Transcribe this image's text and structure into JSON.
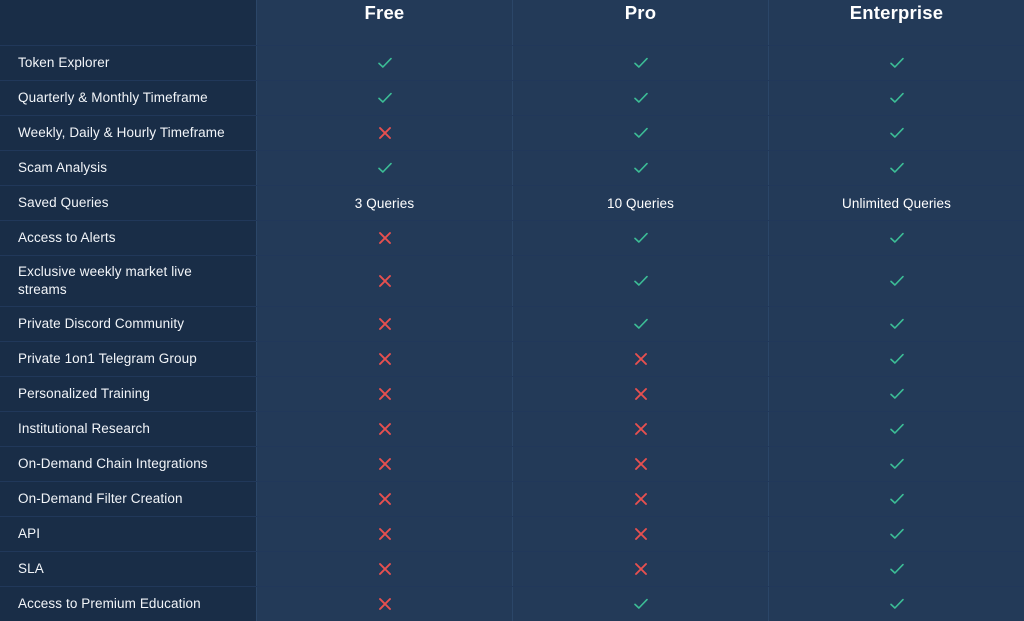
{
  "table": {
    "columns": [
      {
        "key": "feature",
        "label": ""
      },
      {
        "key": "free",
        "label": "Free"
      },
      {
        "key": "pro",
        "label": "Pro"
      },
      {
        "key": "enterprise",
        "label": "Enterprise"
      }
    ],
    "colors": {
      "label_column_bg": "#192d47",
      "value_column_bg": "#233a58",
      "row_divider": "#21385a",
      "column_divider": "#2b4668",
      "check": "#3cbd96",
      "cross": "#e8504f",
      "text": "#f2f5f9"
    },
    "icons": {
      "check": "check-icon",
      "cross": "cross-icon"
    },
    "rows": [
      {
        "label": "Token Explorer",
        "free": "check",
        "pro": "check",
        "enterprise": "check"
      },
      {
        "label": "Quarterly & Monthly Timeframe",
        "free": "check",
        "pro": "check",
        "enterprise": "check"
      },
      {
        "label": "Weekly, Daily & Hourly Timeframe",
        "free": "cross",
        "pro": "check",
        "enterprise": "check"
      },
      {
        "label": "Scam Analysis",
        "free": "check",
        "pro": "check",
        "enterprise": "check"
      },
      {
        "label": "Saved Queries",
        "free": "3 Queries",
        "pro": "10 Queries",
        "enterprise": "Unlimited Queries"
      },
      {
        "label": "Access to Alerts",
        "free": "cross",
        "pro": "check",
        "enterprise": "check"
      },
      {
        "label": "Exclusive weekly market live streams",
        "free": "cross",
        "pro": "check",
        "enterprise": "check",
        "tall": true
      },
      {
        "label": "Private Discord Community",
        "free": "cross",
        "pro": "check",
        "enterprise": "check"
      },
      {
        "label": "Private 1on1 Telegram Group",
        "free": "cross",
        "pro": "cross",
        "enterprise": "check"
      },
      {
        "label": "Personalized Training",
        "free": "cross",
        "pro": "cross",
        "enterprise": "check"
      },
      {
        "label": "Institutional Research",
        "free": "cross",
        "pro": "cross",
        "enterprise": "check"
      },
      {
        "label": "On-Demand Chain Integrations",
        "free": "cross",
        "pro": "cross",
        "enterprise": "check"
      },
      {
        "label": "On-Demand Filter Creation",
        "free": "cross",
        "pro": "cross",
        "enterprise": "check"
      },
      {
        "label": "API",
        "free": "cross",
        "pro": "cross",
        "enterprise": "check"
      },
      {
        "label": "SLA",
        "free": "cross",
        "pro": "cross",
        "enterprise": "check"
      },
      {
        "label": "Access to Premium Education",
        "free": "cross",
        "pro": "check",
        "enterprise": "check"
      }
    ]
  }
}
